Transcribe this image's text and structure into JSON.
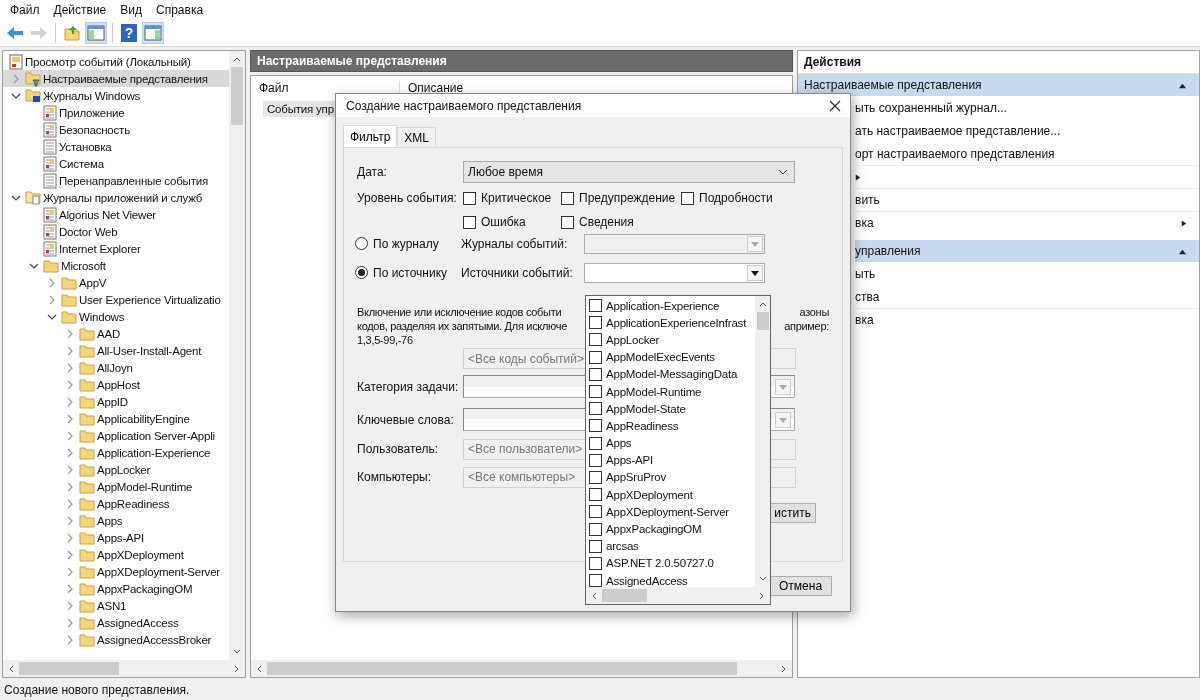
{
  "menu_bar": [
    "Файл",
    "Действие",
    "Вид",
    "Справка"
  ],
  "toolbar": [
    {
      "kind": "back",
      "disabled": false,
      "on": false
    },
    {
      "kind": "forward",
      "disabled": true,
      "on": false
    },
    {
      "kind": "up-folder",
      "disabled": false,
      "on": false
    },
    {
      "kind": "console-tree",
      "disabled": false,
      "on": true
    },
    {
      "kind": "help",
      "label": "?",
      "disabled": false,
      "on": false
    },
    {
      "kind": "action-pane",
      "disabled": false,
      "on": true
    }
  ],
  "tree": {
    "items": [
      {
        "label": "Просмотр событий (Локальный)",
        "kind": "root",
        "selected": false,
        "children": [
          {
            "label": "Настраиваемые представления",
            "kind": "views",
            "expanded": false,
            "selected": true
          },
          {
            "label": "Журналы Windows",
            "kind": "windows-logs",
            "expanded": true,
            "selected": false,
            "children": [
              {
                "label": "Приложение",
                "kind": "log",
                "selected": false
              },
              {
                "label": "Безопасность",
                "kind": "log",
                "selected": false
              },
              {
                "label": "Установка",
                "kind": "log-plain",
                "selected": false
              },
              {
                "label": "Система",
                "kind": "log",
                "selected": false
              },
              {
                "label": "Перенаправленные события",
                "kind": "log-plain",
                "selected": false
              }
            ]
          },
          {
            "label": "Журналы приложений и служб",
            "kind": "app-logs",
            "expanded": true,
            "selected": false,
            "children": [
              {
                "label": "Algorius Net Viewer",
                "kind": "log",
                "selected": false
              },
              {
                "label": "Doctor Web",
                "kind": "log",
                "selected": false
              },
              {
                "label": "Internet Explorer",
                "kind": "log",
                "selected": false
              },
              {
                "label": "Microsoft",
                "kind": "folder",
                "expanded": true,
                "selected": false,
                "children": [
                  {
                    "label": "AppV",
                    "kind": "folder",
                    "expanded": false,
                    "selected": false
                  },
                  {
                    "label": "User Experience Virtualizatio",
                    "kind": "folder",
                    "expanded": false,
                    "selected": false
                  },
                  {
                    "label": "Windows",
                    "kind": "folder",
                    "expanded": true,
                    "selected": false,
                    "children": [
                      {
                        "label": "AAD",
                        "kind": "folder",
                        "expanded": false,
                        "selected": false
                      },
                      {
                        "label": "All-User-Install-Agent",
                        "kind": "folder",
                        "expanded": false,
                        "selected": false
                      },
                      {
                        "label": "AllJoyn",
                        "kind": "folder",
                        "expanded": false,
                        "selected": false
                      },
                      {
                        "label": "AppHost",
                        "kind": "folder",
                        "expanded": false,
                        "selected": false
                      },
                      {
                        "label": "AppID",
                        "kind": "folder",
                        "expanded": false,
                        "selected": false
                      },
                      {
                        "label": "ApplicabilityEngine",
                        "kind": "folder",
                        "expanded": false,
                        "selected": false
                      },
                      {
                        "label": "Application Server-Appli",
                        "kind": "folder",
                        "expanded": false,
                        "selected": false
                      },
                      {
                        "label": "Application-Experience",
                        "kind": "folder",
                        "expanded": false,
                        "selected": false
                      },
                      {
                        "label": "AppLocker",
                        "kind": "folder",
                        "expanded": false,
                        "selected": false
                      },
                      {
                        "label": "AppModel-Runtime",
                        "kind": "folder",
                        "expanded": false,
                        "selected": false
                      },
                      {
                        "label": "AppReadiness",
                        "kind": "folder",
                        "expanded": false,
                        "selected": false
                      },
                      {
                        "label": "Apps",
                        "kind": "folder",
                        "expanded": false,
                        "selected": false
                      },
                      {
                        "label": "Apps-API",
                        "kind": "folder",
                        "expanded": false,
                        "selected": false
                      },
                      {
                        "label": "AppXDeployment",
                        "kind": "folder",
                        "expanded": false,
                        "selected": false
                      },
                      {
                        "label": "AppXDeployment-Server",
                        "kind": "folder",
                        "expanded": false,
                        "selected": false
                      },
                      {
                        "label": "AppxPackagingOM",
                        "kind": "folder",
                        "expanded": false,
                        "selected": false
                      },
                      {
                        "label": "ASN1",
                        "kind": "folder",
                        "expanded": false,
                        "selected": false
                      },
                      {
                        "label": "AssignedAccess",
                        "kind": "folder",
                        "expanded": false,
                        "selected": false
                      },
                      {
                        "label": "AssignedAccessBroker",
                        "kind": "folder",
                        "expanded": false,
                        "selected": false
                      }
                    ]
                  }
                ]
              }
            ]
          }
        ]
      }
    ]
  },
  "center_pane": {
    "title": "Настраиваемые представления",
    "columns": [
      "Файл",
      "Описание"
    ],
    "rows": [
      {
        "cells": [
          "События упр"
        ],
        "selected": true
      }
    ]
  },
  "actions_pane": {
    "title": "Действия",
    "groups": [
      {
        "title": "Настраиваемые представления",
        "expanded": true,
        "items": [
          {
            "text": "ыть сохраненный журнал...",
            "submenu": false,
            "divider": false
          },
          {
            "text": "ать настраиваемое представление...",
            "submenu": false,
            "divider": false
          },
          {
            "text": "орт настраиваемого представления",
            "submenu": false,
            "divider": false
          },
          {
            "submenu": true,
            "divider": true
          },
          {
            "text": "вить",
            "submenu": false,
            "divider": true
          },
          {
            "text": "вка",
            "submenu": true,
            "divider": true
          }
        ]
      },
      {
        "title": "управления",
        "expanded": true,
        "items": [
          {
            "text": "ыть",
            "submenu": false,
            "divider": false
          },
          {
            "text": "ства",
            "submenu": false,
            "divider": false
          },
          {
            "text": "вка",
            "submenu": false,
            "divider": true
          }
        ]
      }
    ]
  },
  "dialog": {
    "title": "Создание настраиваемого представления",
    "tabs": [
      {
        "label": "Фильтр",
        "selected": true
      },
      {
        "label": "XML",
        "selected": false
      }
    ],
    "date": {
      "label": "Дата:",
      "value": "Любое время"
    },
    "level": {
      "label": "Уровень события:",
      "options": [
        {
          "label": "Критическое",
          "checked": false
        },
        {
          "label": "Предупреждение",
          "checked": false
        },
        {
          "label": "Подробности",
          "checked": false
        },
        {
          "label": "Ошибка",
          "checked": false
        },
        {
          "label": "Сведения",
          "checked": false
        }
      ]
    },
    "scope": [
      {
        "label": "По журналу",
        "selected": false,
        "field_label": "Журналы событий:",
        "disabled": true
      },
      {
        "label": "По источнику",
        "selected": true,
        "field_label": "Источники событий:",
        "disabled": false
      }
    ],
    "ids_hint": {
      "left_lines": [
        "Включение или исключение кодов событи",
        "кодов, разделяя их запятыми. Для исключе",
        "1,3,5-99,-76"
      ],
      "right_lines": [
        "азоны",
        "апример:"
      ]
    },
    "ids_field": {
      "placeholder": "<Все коды событий>"
    },
    "combos": [
      {
        "label": "Категория задачи:",
        "disabled": true
      },
      {
        "label": "Ключевые слова:",
        "disabled": true
      }
    ],
    "fields": [
      {
        "label": "Пользователь:",
        "placeholder": "<Все пользователи>"
      },
      {
        "label": "Компьютеры:",
        "placeholder": "<Все компьютеры>"
      }
    ],
    "clear_button": {
      "label": "истить"
    },
    "buttons": [
      {
        "label": "Отмена"
      }
    ],
    "sources_list": {
      "items": [
        {
          "label": "Application-Experience",
          "checked": false
        },
        {
          "label": "ApplicationExperienceInfrast",
          "checked": false
        },
        {
          "label": "AppLocker",
          "checked": false
        },
        {
          "label": "AppModelExecEvents",
          "checked": false
        },
        {
          "label": "AppModel-MessagingData",
          "checked": false
        },
        {
          "label": "AppModel-Runtime",
          "checked": false
        },
        {
          "label": "AppModel-State",
          "checked": false
        },
        {
          "label": "AppReadiness",
          "checked": false
        },
        {
          "label": "Apps",
          "checked": false
        },
        {
          "label": "Apps-API",
          "checked": false
        },
        {
          "label": "AppSruProv",
          "checked": false
        },
        {
          "label": "AppXDeployment",
          "checked": false
        },
        {
          "label": "AppXDeployment-Server",
          "checked": false
        },
        {
          "label": "AppxPackagingOM",
          "checked": false
        },
        {
          "label": "arcsas",
          "checked": false
        },
        {
          "label": "ASP.NET 2.0.50727.0",
          "checked": false
        },
        {
          "label": "AssignedAccess",
          "checked": false
        }
      ]
    }
  },
  "status_bar": {
    "text": "Создание нового представления."
  }
}
